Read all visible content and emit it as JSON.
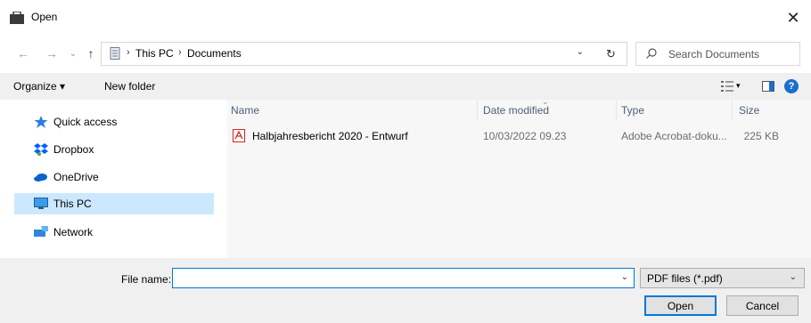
{
  "window": {
    "title": "Open",
    "close_glyph": "✕"
  },
  "nav": {
    "back_glyph": "←",
    "forward_glyph": "→",
    "recent_glyph": "⌄",
    "up_glyph": "↑",
    "breadcrumbs": [
      "This PC",
      "Documents"
    ],
    "separator": "›",
    "dropdown_glyph": "⌄",
    "refresh_glyph": "↻"
  },
  "search": {
    "placeholder": "Search Documents"
  },
  "toolbar": {
    "organize_label": "Organize ▾",
    "new_folder_label": "New folder",
    "view_dropdown_glyph": "▾",
    "help_glyph": "?"
  },
  "sidebar": {
    "items": [
      {
        "label": "Quick access",
        "icon": "star-icon"
      },
      {
        "label": "Dropbox",
        "icon": "dropbox-icon"
      },
      {
        "label": "OneDrive",
        "icon": "cloud-icon"
      },
      {
        "label": "This PC",
        "icon": "monitor-icon",
        "selected": true
      },
      {
        "label": "Network",
        "icon": "network-icon"
      }
    ]
  },
  "columns": {
    "name": "Name",
    "date": "Date modified",
    "type": "Type",
    "size": "Size",
    "sort_glyph": "⌄"
  },
  "files": [
    {
      "name": "Halbjahresbericht 2020 - Entwurf",
      "date": "10/03/2022 09.23",
      "type": "Adobe Acrobat-doku...",
      "size": "225 KB",
      "icon": "pdf-icon"
    }
  ],
  "footer": {
    "file_name_label": "File name:",
    "file_name_value": "",
    "file_name_dropdown_glyph": "⌄",
    "filter_value": "PDF files (*.pdf)",
    "filter_dropdown_glyph": "⌄",
    "open_label": "Open",
    "cancel_label": "Cancel"
  },
  "colors": {
    "accent": "#0078d7",
    "selection": "#cce8ff",
    "pdf_red": "#d9241c"
  }
}
